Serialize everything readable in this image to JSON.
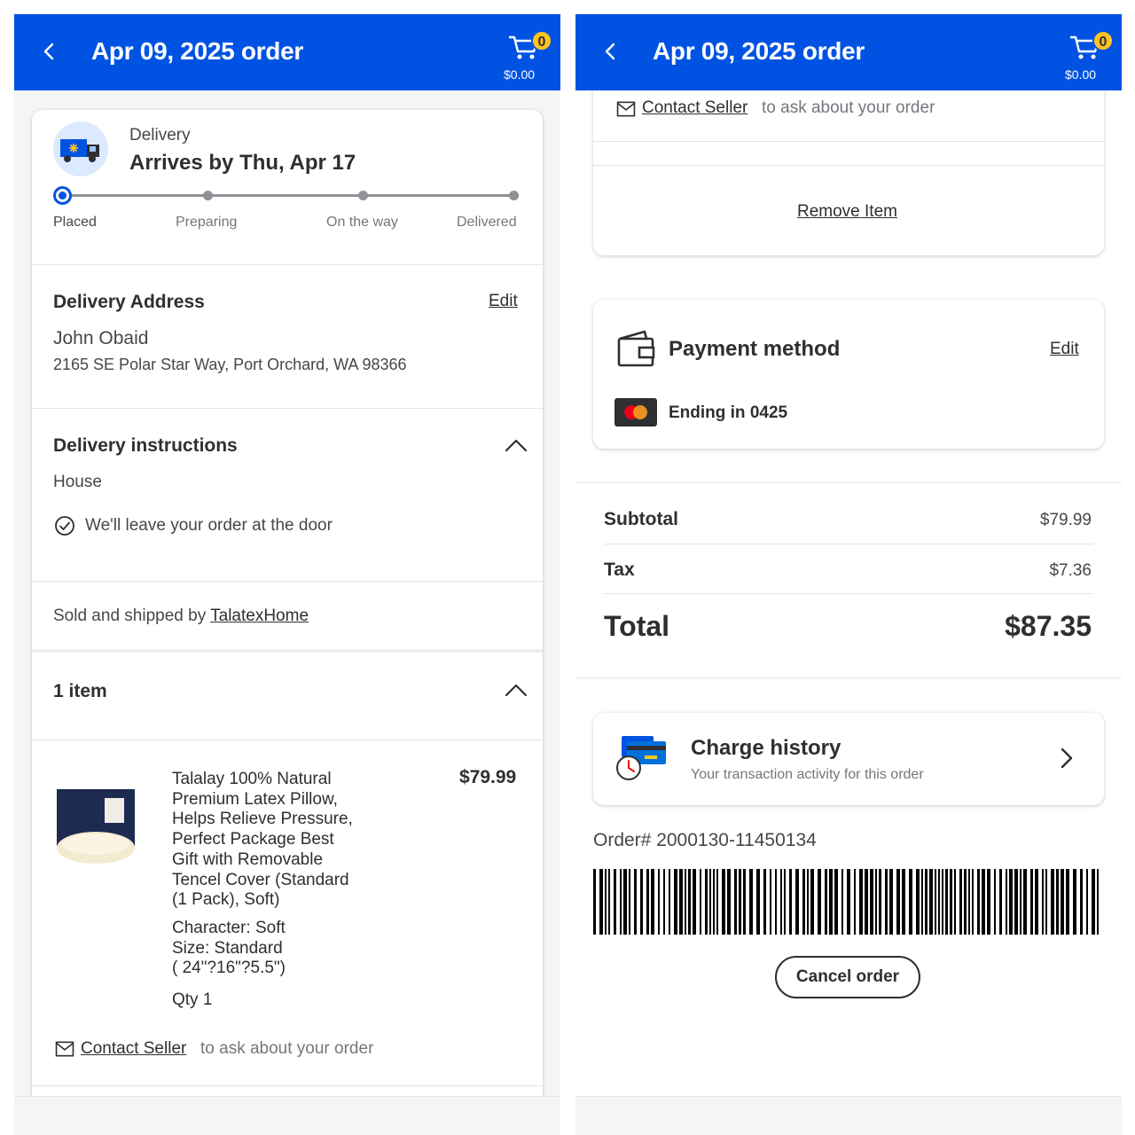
{
  "header": {
    "title": "Apr 09, 2025 order",
    "cart_count": "0",
    "cart_amount": "$0.00"
  },
  "delivery": {
    "type": "Delivery",
    "arrival": "Arrives by Thu, Apr 17",
    "steps": [
      "Placed",
      "Preparing",
      "On the way",
      "Delivered"
    ],
    "progress_step": 1
  },
  "address": {
    "heading": "Delivery Address",
    "edit": "Edit",
    "name": "John Obaid",
    "line": "2165 SE Polar Star Way, Port Orchard, WA 98366"
  },
  "instructions": {
    "heading": "Delivery instructions",
    "type": "House",
    "note": "We'll leave your order at the door"
  },
  "seller": {
    "prefix": "Sold and shipped by",
    "name": "TalatexHome"
  },
  "items": {
    "count_label": "1 item",
    "product": {
      "title_lines": [
        "Talalay 100% Natural",
        "Premium Latex Pillow,",
        "Helps Relieve Pressure,",
        "Perfect Package Best",
        "Gift with Removable",
        "Tencel Cover (Standard",
        "(1 Pack), Soft)"
      ],
      "price": "$79.99",
      "attr_lines": [
        "Character: Soft",
        "Size: Standard",
        "( 24\"?16\"?5.5\")"
      ],
      "qty": "Qty 1"
    },
    "contact_link": "Contact Seller",
    "contact_suffix": "to ask about your order",
    "remove": "Remove Item"
  },
  "payment": {
    "heading": "Payment method",
    "edit": "Edit",
    "card": "Ending in 0425"
  },
  "summary": {
    "subtotal_label": "Subtotal",
    "subtotal": "$79.99",
    "tax_label": "Tax",
    "tax": "$7.36",
    "total_label": "Total",
    "total": "$87.35"
  },
  "charge_history": {
    "title": "Charge history",
    "subtitle": "Your transaction activity for this order"
  },
  "order": {
    "number": "Order# 2000130-11450134",
    "cancel": "Cancel order"
  },
  "colors": {
    "brand_blue": "#0053e2",
    "spark_yellow": "#ffc220"
  }
}
